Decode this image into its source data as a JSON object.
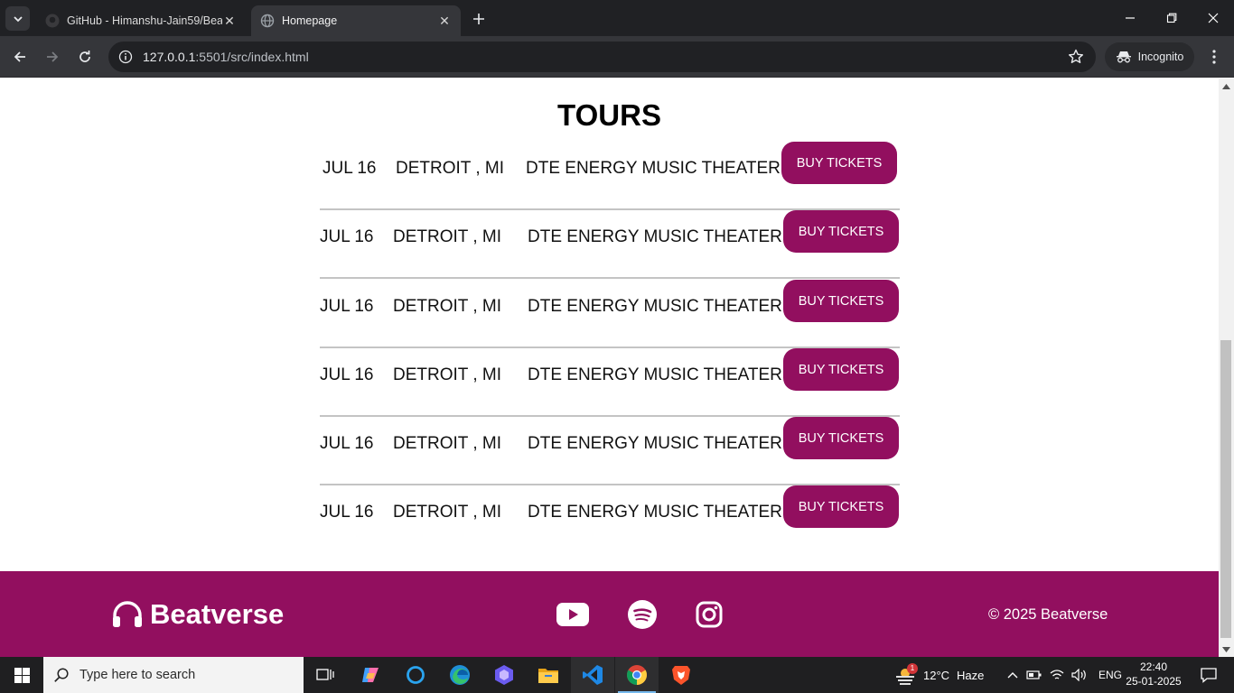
{
  "browser": {
    "tabs": [
      {
        "title": "GitHub - Himanshu-Jain59/Bea",
        "active": false
      },
      {
        "title": "Homepage",
        "active": true
      }
    ],
    "url_host": "127.0.0.1",
    "url_path": ":5501/src/index.html",
    "incognito_label": "Incognito"
  },
  "page": {
    "tours_title": "TOURS",
    "tours": [
      {
        "date": "JUL 16",
        "city": "DETROIT , MI",
        "venue": "DTE ENERGY MUSIC THEATER",
        "button": "BUY TICKETS"
      },
      {
        "date": "JUL 16",
        "city": "DETROIT , MI",
        "venue": "DTE ENERGY MUSIC THEATER",
        "button": "BUY TICKETS"
      },
      {
        "date": "JUL 16",
        "city": "DETROIT , MI",
        "venue": "DTE ENERGY MUSIC THEATER",
        "button": "BUY TICKETS"
      },
      {
        "date": "JUL 16",
        "city": "DETROIT , MI",
        "venue": "DTE ENERGY MUSIC THEATER",
        "button": "BUY TICKETS"
      },
      {
        "date": "JUL 16",
        "city": "DETROIT , MI",
        "venue": "DTE ENERGY MUSIC THEATER",
        "button": "BUY TICKETS"
      },
      {
        "date": "JUL 16",
        "city": "DETROIT , MI",
        "venue": "DTE ENERGY MUSIC THEATER",
        "button": "BUY TICKETS"
      }
    ],
    "footer": {
      "brand": "Beatverse",
      "social": [
        "youtube-icon",
        "spotify-icon",
        "instagram-icon"
      ],
      "copyright": "© 2025 Beatverse"
    },
    "colors": {
      "accent": "#920f5f"
    }
  },
  "taskbar": {
    "search_placeholder": "Type here to search",
    "weather_temp": "12°C",
    "weather_text": "Haze",
    "weather_badge": "1",
    "language": "ENG",
    "time": "22:40",
    "date": "25-01-2025"
  }
}
